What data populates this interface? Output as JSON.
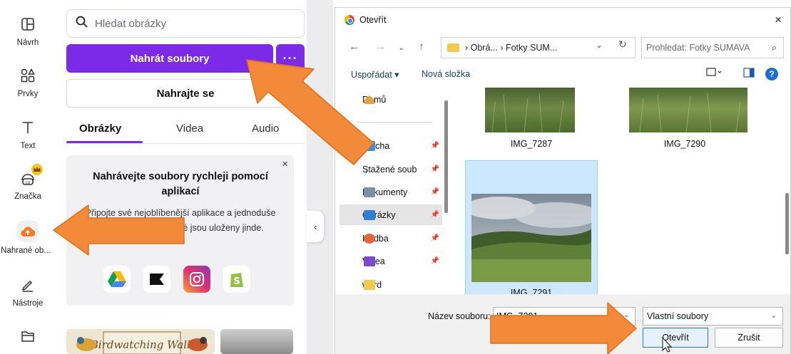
{
  "rail": {
    "items": [
      {
        "label": "Návrh",
        "icon": "layout-icon"
      },
      {
        "label": "Prvky",
        "icon": "shapes-icon"
      },
      {
        "label": "Text",
        "icon": "text-icon"
      },
      {
        "label": "Značka",
        "icon": "brand-icon"
      },
      {
        "label": "Nahrané ob...",
        "icon": "upload-cloud-icon"
      },
      {
        "label": "Nástroje",
        "icon": "tools-icon"
      },
      {
        "label": "",
        "icon": "folder-icon"
      }
    ]
  },
  "panel": {
    "search_placeholder": "Hledat obrázky",
    "upload_button": "Nahrát soubory",
    "more_button": "···",
    "record_button": "Nahrajte se",
    "tabs": [
      "Obrázky",
      "Videa",
      "Audio"
    ],
    "promo": {
      "close": "×",
      "title": "Nahrávejte soubory rychleji pomocí aplikací",
      "text": "Připojte své nejoblíbenější aplikace a jednoduše nahrajte soubory, které jsou uloženy jinde.",
      "apps": [
        "google-drive-icon",
        "dropbox-icon",
        "instagram-icon",
        "shopify-icon"
      ]
    },
    "thumb_text": "Birdwatching Walk"
  },
  "dialog": {
    "title": "Otevřít",
    "close": "×",
    "breadcrumb": "›  Obrá...  ›  Fotky SUM...",
    "search_placeholder": "Prohledat: Fotky SUMAVA",
    "toolbar": {
      "organize": "Uspořádat ▾",
      "new_folder": "Nová složka",
      "help": "?"
    },
    "nav": [
      {
        "label": "Domů",
        "icon": "home-icon",
        "color": "#e4a23b"
      },
      {
        "label": "Plocha",
        "icon": "desktop-icon",
        "color": "#3a8ee6"
      },
      {
        "label": "Stažené soub",
        "icon": "download-icon",
        "color": "#2b7bd6"
      },
      {
        "label": "Dokumenty",
        "icon": "documents-icon",
        "color": "#7b8fa8"
      },
      {
        "label": "Obrázky",
        "icon": "pictures-icon",
        "color": "#2f7fd9"
      },
      {
        "label": "Hudba",
        "icon": "music-icon",
        "color": "#e06a3c"
      },
      {
        "label": "Videa",
        "icon": "videos-icon",
        "color": "#7d4bc9"
      },
      {
        "label": "word",
        "icon": "folder-icon",
        "color": "#f3c950"
      }
    ],
    "files": [
      {
        "name": "IMG_7287"
      },
      {
        "name": "IMG_7290"
      },
      {
        "name": "IMG_7291",
        "selected": true
      }
    ],
    "filename_label": "Název souboru:",
    "filename_value": "IMG_7291",
    "filetype": "Vlastní soubory",
    "open_button": "Otevřít",
    "cancel_button": "Zrušit"
  },
  "colors": {
    "canva_purple": "#7d2ae8",
    "annotation_orange": "#f28a3a",
    "selection_blue": "#cce8ff"
  }
}
